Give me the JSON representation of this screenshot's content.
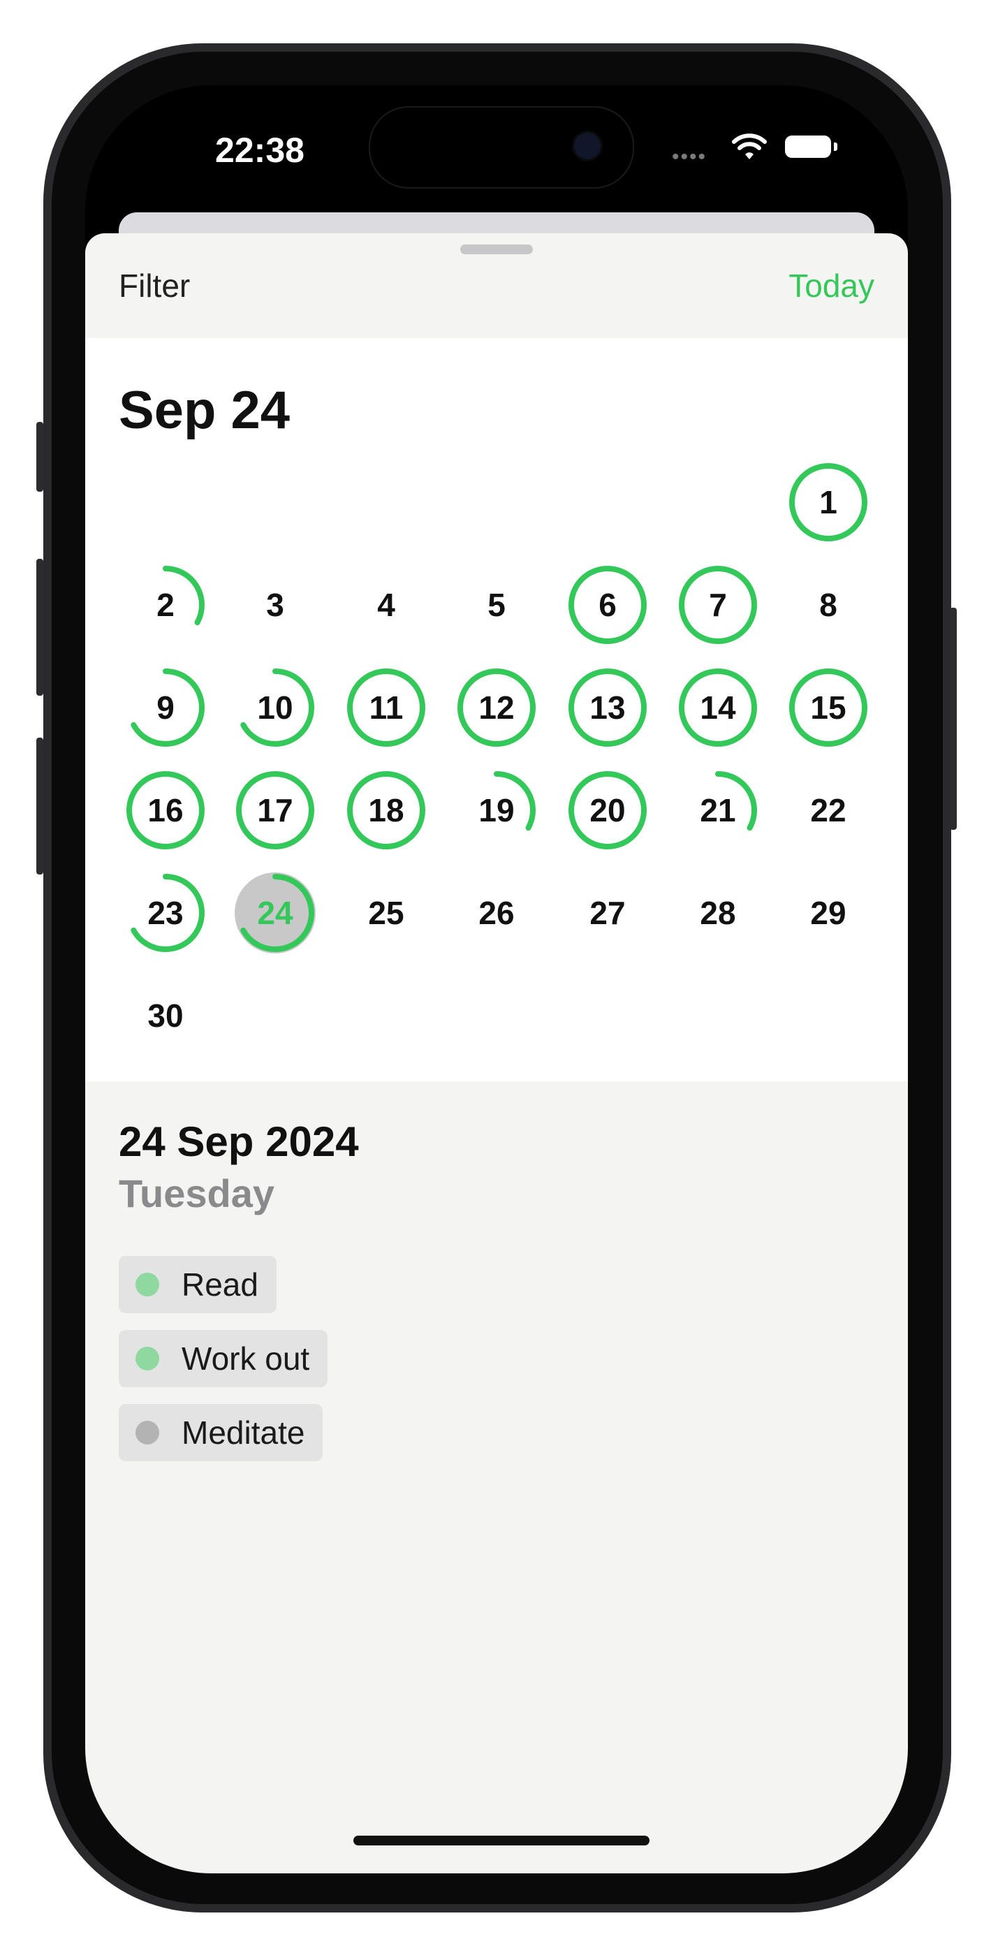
{
  "status_bar": {
    "time": "22:38",
    "signal_icon": "signal-dots-icon",
    "wifi_icon": "wifi-icon",
    "battery_icon": "battery-icon"
  },
  "nav": {
    "filter_label": "Filter",
    "today_label": "Today"
  },
  "calendar": {
    "month_title": "Sep 24",
    "accent_color": "#34c759",
    "days": [
      {
        "day": "1",
        "progress": 1
      },
      {
        "day": "2",
        "progress": 0.33
      },
      {
        "day": "3",
        "progress": 0
      },
      {
        "day": "4",
        "progress": 0
      },
      {
        "day": "5",
        "progress": 0
      },
      {
        "day": "6",
        "progress": 1
      },
      {
        "day": "7",
        "progress": 1
      },
      {
        "day": "8",
        "progress": 0
      },
      {
        "day": "9",
        "progress": 0.67
      },
      {
        "day": "10",
        "progress": 0.67
      },
      {
        "day": "11",
        "progress": 1
      },
      {
        "day": "12",
        "progress": 1
      },
      {
        "day": "13",
        "progress": 1
      },
      {
        "day": "14",
        "progress": 1
      },
      {
        "day": "15",
        "progress": 1
      },
      {
        "day": "16",
        "progress": 1
      },
      {
        "day": "17",
        "progress": 1
      },
      {
        "day": "18",
        "progress": 1
      },
      {
        "day": "19",
        "progress": 0.33
      },
      {
        "day": "20",
        "progress": 1
      },
      {
        "day": "21",
        "progress": 0.33
      },
      {
        "day": "22",
        "progress": 0
      },
      {
        "day": "23",
        "progress": 0.67
      },
      {
        "day": "24",
        "progress": 0.67,
        "selected": true
      },
      {
        "day": "25",
        "progress": 0
      },
      {
        "day": "26",
        "progress": 0
      },
      {
        "day": "27",
        "progress": 0
      },
      {
        "day": "28",
        "progress": 0
      },
      {
        "day": "29",
        "progress": 0
      },
      {
        "day": "30",
        "progress": 0
      }
    ]
  },
  "detail": {
    "date": "24 Sep 2024",
    "weekday": "Tuesday",
    "habits": [
      {
        "label": "Read",
        "done": true,
        "color": "#8fd9a0"
      },
      {
        "label": "Work out",
        "done": true,
        "color": "#8fd9a0"
      },
      {
        "label": "Meditate",
        "done": false,
        "color": "#b3b3b3"
      }
    ]
  }
}
